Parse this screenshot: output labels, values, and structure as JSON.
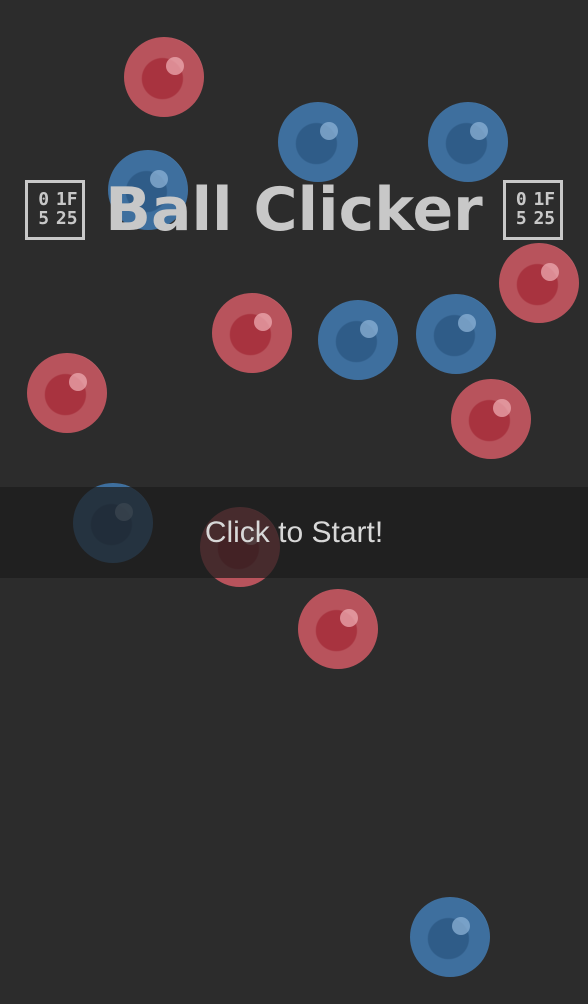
{
  "title": {
    "text": "Ball Clicker",
    "emoji_left": {
      "icon": "dart-emoji-icon",
      "codepoint": [
        "0",
        "1F",
        "5",
        "25"
      ]
    },
    "emoji_right": {
      "icon": "dart-emoji-icon",
      "codepoint": [
        "0",
        "1F",
        "5",
        "25"
      ]
    }
  },
  "start_prompt": "Click to Start!",
  "colors": {
    "background": "#2c2c2c",
    "red_ball": "#b8535c",
    "blue_ball": "#3e6f9e",
    "title_text": "#c8c8c8",
    "prompt_band": "#1c1c1c"
  }
}
